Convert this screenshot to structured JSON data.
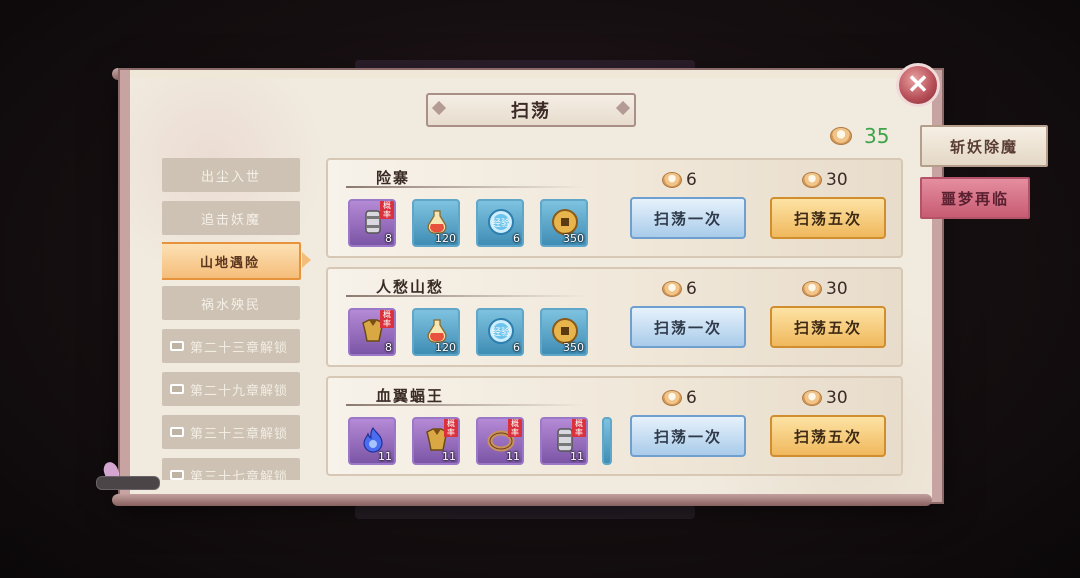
{
  "dialog": {
    "title": "扫荡",
    "close_icon": "close-icon"
  },
  "stamina": {
    "icon": "bun-icon",
    "value": "35",
    "color": "#3ea34a"
  },
  "side_tabs": [
    {
      "label": "斩妖除魔",
      "active": true
    },
    {
      "label": "噩梦再临",
      "active": false
    }
  ],
  "chapters": [
    {
      "label": "出尘入世",
      "state": "normal"
    },
    {
      "label": "追击妖魔",
      "state": "normal"
    },
    {
      "label": "山地遇险",
      "state": "active"
    },
    {
      "label": "祸水殃民",
      "state": "normal"
    },
    {
      "label": "第二十三章解锁",
      "state": "locked"
    },
    {
      "label": "第二十九章解锁",
      "state": "locked"
    },
    {
      "label": "第三十三章解锁",
      "state": "locked"
    },
    {
      "label": "第三十七章解锁",
      "state": "locked"
    }
  ],
  "stages": [
    {
      "name": "险寨",
      "rewards": [
        {
          "icon": "bracer-icon",
          "rarity": "purple",
          "qty": "8",
          "chance_tag": true
        },
        {
          "icon": "potion-icon",
          "rarity": "blue",
          "qty": "120",
          "chance_tag": false
        },
        {
          "icon": "exp-orb-icon",
          "rarity": "blue",
          "qty": "6",
          "chance_tag": false,
          "orb_text": "经验"
        },
        {
          "icon": "copper-coin-icon",
          "rarity": "blue",
          "qty": "350",
          "chance_tag": false
        }
      ],
      "cost_once": "6",
      "cost_five": "30",
      "btn_once": "扫荡一次",
      "btn_five": "扫荡五次"
    },
    {
      "name": "人愁山愁",
      "rewards": [
        {
          "icon": "armor-icon",
          "rarity": "purple",
          "qty": "8",
          "chance_tag": true
        },
        {
          "icon": "potion-icon",
          "rarity": "blue",
          "qty": "120",
          "chance_tag": false
        },
        {
          "icon": "exp-orb-icon",
          "rarity": "blue",
          "qty": "6",
          "chance_tag": false,
          "orb_text": "经验"
        },
        {
          "icon": "copper-coin-icon",
          "rarity": "blue",
          "qty": "350",
          "chance_tag": false
        }
      ],
      "cost_once": "6",
      "cost_five": "30",
      "btn_once": "扫荡一次",
      "btn_five": "扫荡五次"
    },
    {
      "name": "血翼蝠王",
      "rewards": [
        {
          "icon": "blue-flame-icon",
          "rarity": "purple",
          "qty": "11",
          "chance_tag": false
        },
        {
          "icon": "armor-icon",
          "rarity": "purple",
          "qty": "11",
          "chance_tag": true
        },
        {
          "icon": "ring-icon",
          "rarity": "purple",
          "qty": "11",
          "chance_tag": true
        },
        {
          "icon": "bracer-icon",
          "rarity": "purple",
          "qty": "11",
          "chance_tag": true
        }
      ],
      "cost_once": "6",
      "cost_five": "30",
      "btn_once": "扫荡一次",
      "btn_five": "扫荡五次"
    }
  ],
  "chance_label": "概率",
  "colors": {
    "panel": "#f1ebdf",
    "btn_once": "#a9cbea",
    "btn_five": "#f0b85d",
    "active_tab": "#f5bd7a"
  }
}
